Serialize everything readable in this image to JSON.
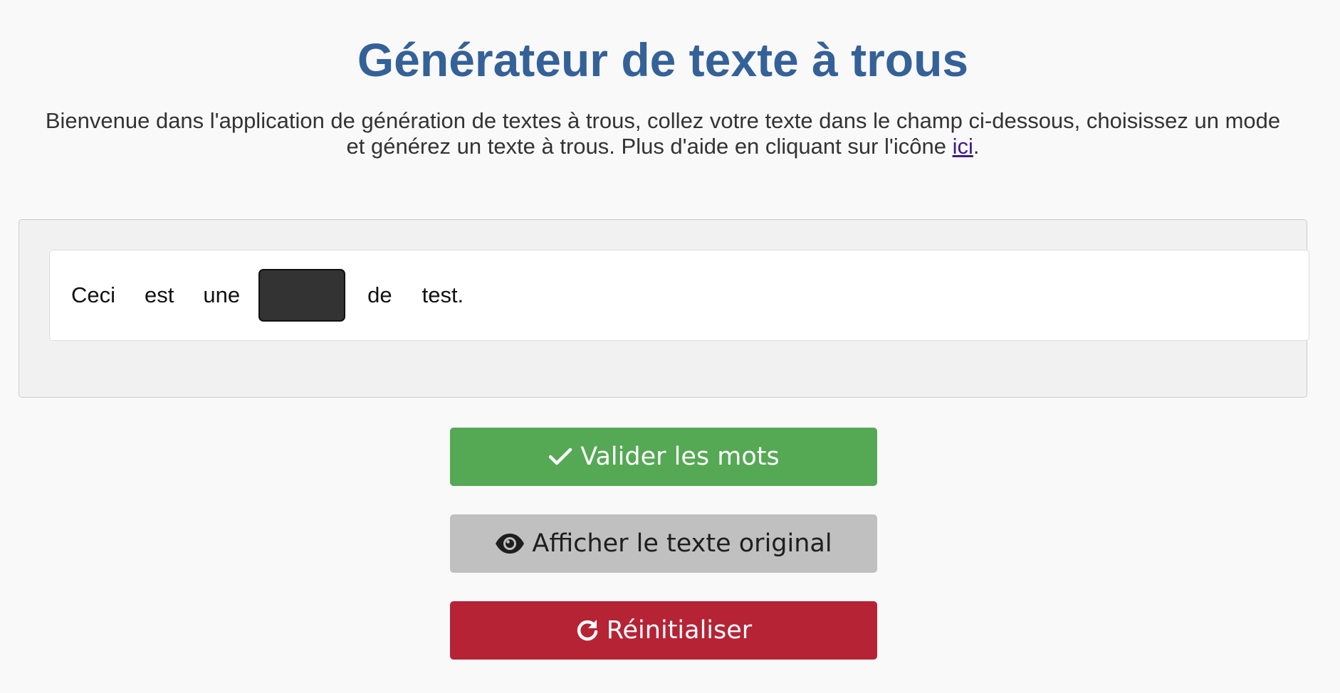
{
  "header": {
    "title": "Générateur de texte à trous",
    "intro_text": "Bienvenue dans l'application de génération de textes à trous, collez votre texte dans le champ ci-dessous, choisissez un mode et générez un texte à trous. Plus d'aide en cliquant sur l'icône ",
    "help_link_label": "ici",
    "intro_end": "."
  },
  "exercise": {
    "words": [
      "Ceci",
      "est",
      "une",
      "",
      "de",
      "test."
    ],
    "blank_color": "#333333"
  },
  "actions": {
    "validate_label": "Valider les mots",
    "validate_icon": "check-icon",
    "show_original_label": "Afficher le texte original",
    "show_original_icon": "eye-icon",
    "reset_label": "Réinitialiser",
    "reset_icon": "redo-icon"
  },
  "colors": {
    "title": "#346198",
    "validate": "#55a854",
    "show_original": "#c0c0c0",
    "reset": "#b52335"
  }
}
